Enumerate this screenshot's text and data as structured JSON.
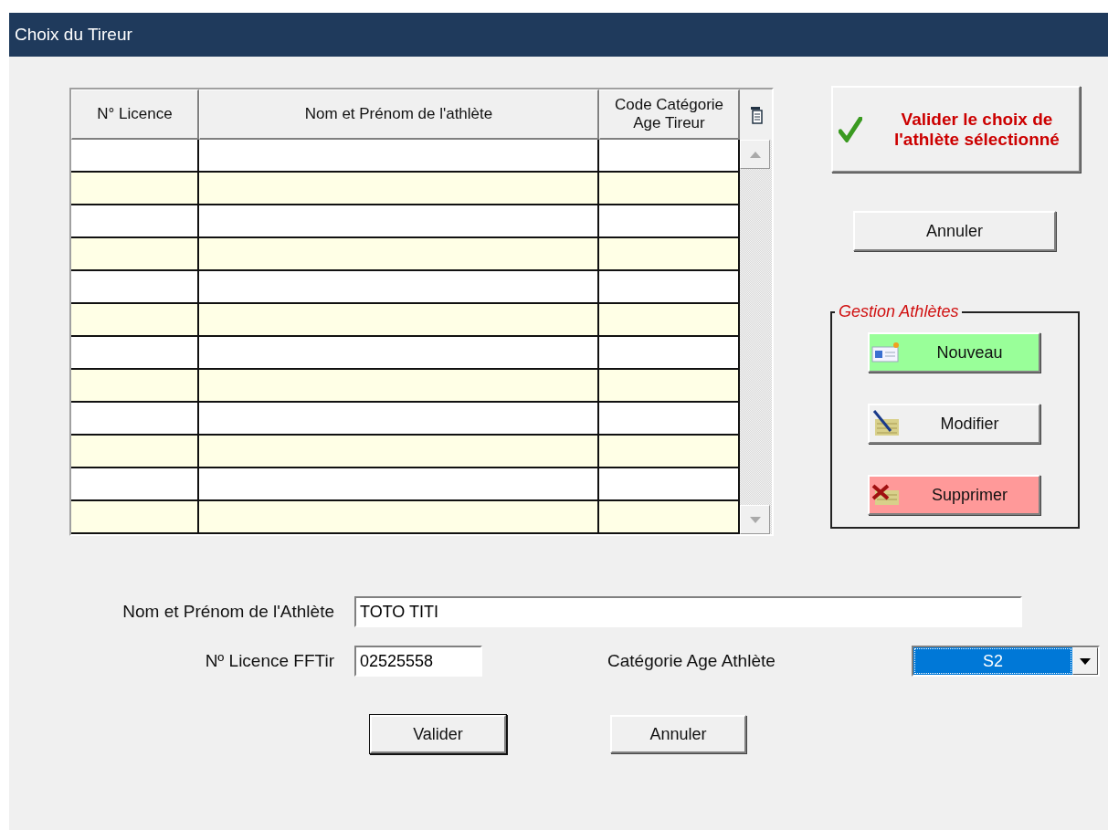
{
  "window": {
    "title": "Choix du Tireur"
  },
  "table": {
    "columns": [
      "N° Licence",
      "Nom et Prénom de l'athlète",
      "Code Catégorie Age Tireur"
    ]
  },
  "confirm_button": {
    "label": "Valider  le choix de l'athlète sélectionné"
  },
  "cancel_button": {
    "label": "Annuler"
  },
  "athletes_group": {
    "title": "Gestion Athlètes",
    "buttons": [
      {
        "kind": "new",
        "label": "Nouveau",
        "color": "#99ff99"
      },
      {
        "kind": "edit",
        "label": "Modifier",
        "color": "#f0f0f0"
      },
      {
        "kind": "delete",
        "label": "Supprimer",
        "color": "#ff9999"
      }
    ]
  },
  "form": {
    "name_label": "Nom et Prénom de l'Athlète",
    "name_value": "TOTO TITI",
    "licence_label": "Nº Licence FFTir",
    "licence_value": "02525558",
    "category_label": "Catégorie Age Athlète",
    "category_value": "S2",
    "buttons": [
      {
        "label": "Valider",
        "default": true
      },
      {
        "label": "Annuler",
        "default": false
      }
    ]
  }
}
